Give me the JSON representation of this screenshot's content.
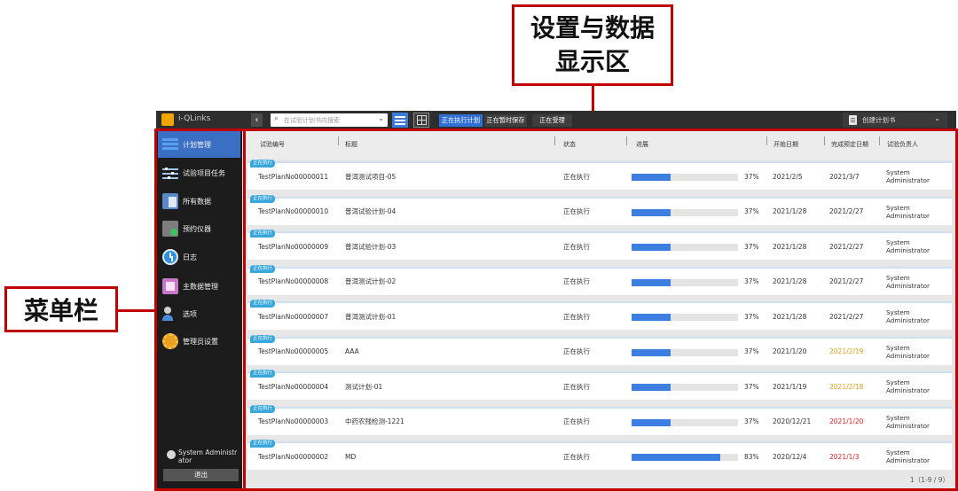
{
  "annotations": {
    "settings_area_line1": "设置与数据",
    "settings_area_line2": "显示区",
    "menu_bar": "菜单栏"
  },
  "app": {
    "title": "i-QLinks",
    "search_placeholder": "在试验计划书内搜索",
    "filter_tabs": [
      "正在执行计划",
      "正在暂时保存",
      "正在受理"
    ],
    "create_plan": "创建计划书"
  },
  "sidebar": {
    "items": [
      {
        "label": "计划管理",
        "icon": "list-icon"
      },
      {
        "label": "试验项目任务",
        "icon": "task-tree-icon"
      },
      {
        "label": "所有数据",
        "icon": "documents-icon"
      },
      {
        "label": "预约仪器",
        "icon": "device-icon"
      },
      {
        "label": "日志",
        "icon": "clock-icon"
      },
      {
        "label": "主数据管理",
        "icon": "master-data-icon"
      },
      {
        "label": "选项",
        "icon": "options-icon"
      },
      {
        "label": "管理员设置",
        "icon": "gear-icon"
      }
    ],
    "user": "System Administrator",
    "logout": "退出"
  },
  "table": {
    "headers": {
      "id": "试验编号",
      "title": "标题",
      "status": "状态",
      "progress": "进展",
      "start": "开始日期",
      "due": "完成预定日期",
      "owner": "试验负责人"
    },
    "rows": [
      {
        "badge": "正在执行",
        "id": "TestPlanNo00000011",
        "title": "普洱测试项目-05",
        "status": "正在执行",
        "progress": 37,
        "pct": "37%",
        "start": "2021/2/5",
        "due": "2021/3/7",
        "due_state": "normal",
        "owner": "System Administrator"
      },
      {
        "badge": "正在执行",
        "id": "TestPlanNo00000010",
        "title": "普洱试验计划-04",
        "status": "正在执行",
        "progress": 37,
        "pct": "37%",
        "start": "2021/1/28",
        "due": "2021/2/27",
        "due_state": "normal",
        "owner": "System Administrator"
      },
      {
        "badge": "正在执行",
        "id": "TestPlanNo00000009",
        "title": "普洱试验计划-03",
        "status": "正在执行",
        "progress": 37,
        "pct": "37%",
        "start": "2021/1/28",
        "due": "2021/2/27",
        "due_state": "normal",
        "owner": "System Administrator"
      },
      {
        "badge": "正在执行",
        "id": "TestPlanNo00000008",
        "title": "普洱测试计划-02",
        "status": "正在执行",
        "progress": 37,
        "pct": "37%",
        "start": "2021/1/28",
        "due": "2021/2/27",
        "due_state": "normal",
        "owner": "System Administrator"
      },
      {
        "badge": "正在执行",
        "id": "TestPlanNo00000007",
        "title": "普洱测试计划-01",
        "status": "正在执行",
        "progress": 37,
        "pct": "37%",
        "start": "2021/1/28",
        "due": "2021/2/27",
        "due_state": "normal",
        "owner": "System Administrator"
      },
      {
        "badge": "正在执行",
        "id": "TestPlanNo00000005",
        "title": "AAA",
        "status": "正在执行",
        "progress": 37,
        "pct": "37%",
        "start": "2021/1/20",
        "due": "2021/2/19",
        "due_state": "warn",
        "owner": "System Administrator"
      },
      {
        "badge": "正在执行",
        "id": "TestPlanNo00000004",
        "title": "测试计划-01",
        "status": "正在执行",
        "progress": 37,
        "pct": "37%",
        "start": "2021/1/19",
        "due": "2021/2/18",
        "due_state": "warn",
        "owner": "System Administrator"
      },
      {
        "badge": "正在执行",
        "id": "TestPlanNo00000003",
        "title": "中药农残检测-1221",
        "status": "正在执行",
        "progress": 37,
        "pct": "37%",
        "start": "2020/12/21",
        "due": "2021/1/20",
        "due_state": "late",
        "owner": "System Administrator"
      },
      {
        "badge": "正在执行",
        "id": "TestPlanNo00000002",
        "title": "MD",
        "status": "正在执行",
        "progress": 83,
        "pct": "83%",
        "start": "2020/12/4",
        "due": "2021/1/3",
        "due_state": "late",
        "owner": "System Administrator"
      }
    ],
    "pager": "1（1-9 / 9）"
  }
}
